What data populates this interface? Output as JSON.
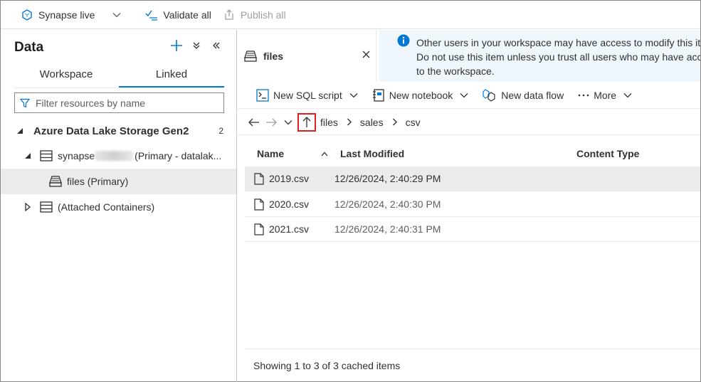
{
  "toolbar": {
    "synapse_live": "Synapse live",
    "validate_all": "Validate all",
    "publish_all": "Publish all"
  },
  "left": {
    "title": "Data",
    "tabs": [
      {
        "label": "Workspace"
      },
      {
        "label": "Linked"
      }
    ],
    "active_tab": "Linked",
    "filter_placeholder": "Filter resources by name",
    "tree": {
      "group_label": "Azure Data Lake Storage Gen2",
      "group_count": "2",
      "account_prefix": "synapse",
      "account_suffix": "(Primary - datalak...",
      "container_label": "files (Primary)",
      "attached_label": "(Attached Containers)"
    }
  },
  "right": {
    "tab_title": "files",
    "info_lines": [
      "Other users in your workspace may have access to modify this it",
      "Do not use this item unless you trust all users who may have acc",
      "to the workspace."
    ],
    "actions": {
      "new_sql_script": "New SQL script",
      "new_notebook": "New notebook",
      "new_data_flow": "New data flow",
      "more": "More"
    },
    "breadcrumb": [
      "files",
      "sales",
      "csv"
    ],
    "columns": {
      "name": "Name",
      "last_modified": "Last Modified",
      "content_type": "Content Type"
    },
    "files": [
      {
        "name": "2019.csv",
        "modified": "12/26/2024, 2:40:29 PM"
      },
      {
        "name": "2020.csv",
        "modified": "12/26/2024, 2:40:30 PM"
      },
      {
        "name": "2021.csv",
        "modified": "12/26/2024, 2:40:31 PM"
      }
    ],
    "status": "Showing 1 to 3 of 3 cached items"
  },
  "colors": {
    "accent": "#0078d4",
    "highlight_box": "#e02020",
    "info_bg": "#eff6fc"
  }
}
